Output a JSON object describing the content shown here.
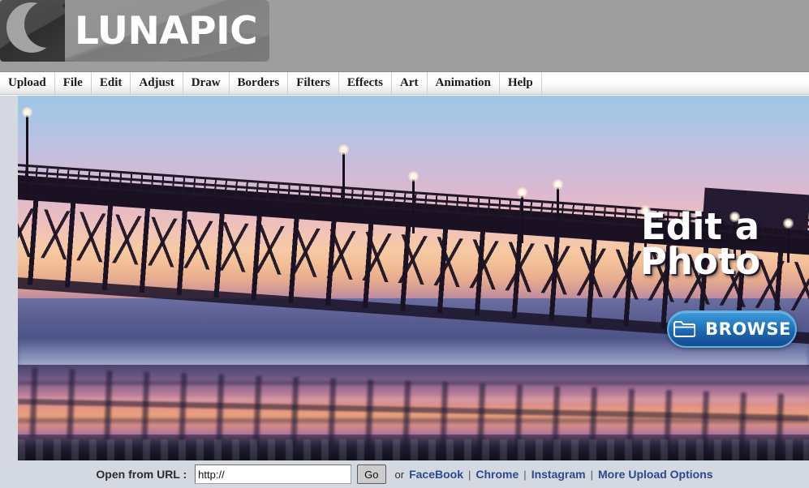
{
  "header": {
    "logo_word": "LUNAPIC",
    "moon_icon": "crescent-moon-icon",
    "background_color": "#9e9e9e"
  },
  "menu": {
    "items": [
      {
        "label": "Upload"
      },
      {
        "label": "File"
      },
      {
        "label": "Edit"
      },
      {
        "label": "Adjust"
      },
      {
        "label": "Draw"
      },
      {
        "label": "Borders"
      },
      {
        "label": "Filters"
      },
      {
        "label": "Effects"
      },
      {
        "label": "Art"
      },
      {
        "label": "Animation"
      },
      {
        "label": "Help"
      }
    ]
  },
  "hero": {
    "headline_line1": "Edit a",
    "headline_line2": "Photo",
    "browse_label": "BROWSE",
    "browse_icon": "folder-icon",
    "browse_color": "#2b82c7",
    "photo_description": "Sunset silhouette of a wooden ocean pier with lamp posts, reflected on wet sand"
  },
  "bottom_bar": {
    "url_label": "Open from URL :",
    "url_value": "http://",
    "url_placeholder": "http://",
    "go_label": "Go",
    "or_text": "or",
    "separator": "|",
    "links": [
      {
        "label": "FaceBook"
      },
      {
        "label": "Chrome"
      },
      {
        "label": "Instagram"
      },
      {
        "label": "More Upload Options"
      }
    ],
    "link_color": "#2a4a8f",
    "background_color": "#d4d8e0"
  }
}
